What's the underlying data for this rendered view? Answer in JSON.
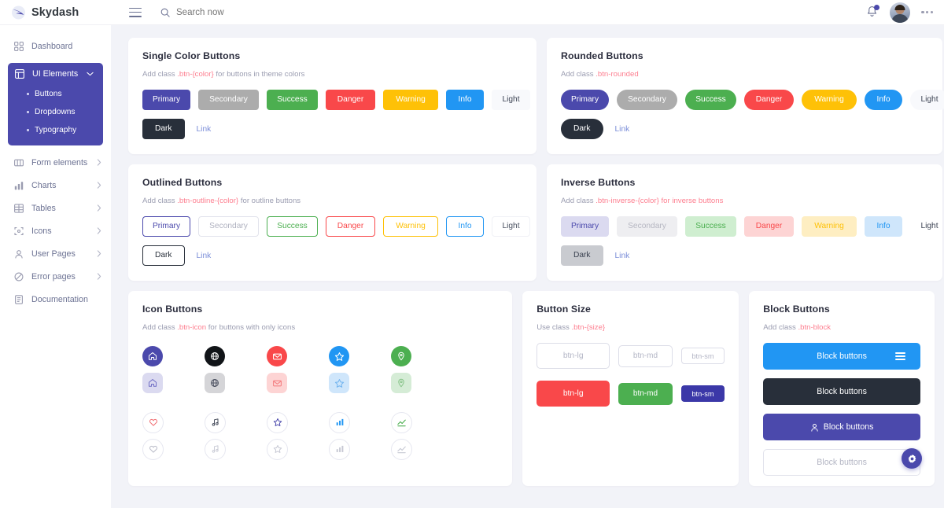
{
  "brand": {
    "name": "Skydash",
    "logo_icon": "wing-logo-icon"
  },
  "header": {
    "menu_icon": "hamburger-icon",
    "search_icon": "search-icon",
    "search_placeholder": "Search now",
    "search_value": "",
    "bell_icon": "bell-icon",
    "avatar_icon": "user-avatar",
    "more_icon": "more-horizontal-icon"
  },
  "sidebar": {
    "items": [
      {
        "label": "Dashboard",
        "icon": "grid-icon",
        "has_chevron": false,
        "active": false
      },
      {
        "label": "UI Elements",
        "icon": "layout-icon",
        "has_chevron": true,
        "active": true,
        "children": [
          {
            "label": "Buttons",
            "active": true
          },
          {
            "label": "Dropdowns",
            "active": false
          },
          {
            "label": "Typography",
            "active": false
          }
        ]
      },
      {
        "label": "Form elements",
        "icon": "columns-icon",
        "has_chevron": true,
        "active": false
      },
      {
        "label": "Charts",
        "icon": "bar-chart-icon",
        "has_chevron": true,
        "active": false
      },
      {
        "label": "Tables",
        "icon": "table-icon",
        "has_chevron": true,
        "active": false
      },
      {
        "label": "Icons",
        "icon": "icons-icon",
        "has_chevron": true,
        "active": false
      },
      {
        "label": "User Pages",
        "icon": "user-icon",
        "has_chevron": true,
        "active": false
      },
      {
        "label": "Error pages",
        "icon": "slash-icon",
        "has_chevron": true,
        "active": false
      },
      {
        "label": "Documentation",
        "icon": "file-text-icon",
        "has_chevron": false,
        "active": false
      }
    ]
  },
  "colors": {
    "primary": "#4B49AC",
    "secondary": "#acacac",
    "success": "#4caf50",
    "danger": "#f9484a",
    "warning": "#fec107",
    "info": "#2196f3",
    "light": "#f8f9fc",
    "dark": "#282f3a",
    "link": "#7a8dd8",
    "code": "#fd7e8f",
    "page_bg": "#f2f3f8"
  },
  "cards": {
    "single_color": {
      "title": "Single Color Buttons",
      "desc_prefix": "Add class",
      "desc_code": ".btn-{color}",
      "desc_suffix": "for buttons in theme colors",
      "buttons": [
        {
          "label": "Primary",
          "variant": "primary"
        },
        {
          "label": "Secondary",
          "variant": "secondary"
        },
        {
          "label": "Success",
          "variant": "success"
        },
        {
          "label": "Danger",
          "variant": "danger"
        },
        {
          "label": "Warning",
          "variant": "warning"
        },
        {
          "label": "Info",
          "variant": "info"
        },
        {
          "label": "Light",
          "variant": "light"
        },
        {
          "label": "Dark",
          "variant": "dark"
        }
      ],
      "link_label": "Link"
    },
    "rounded": {
      "title": "Rounded Buttons",
      "desc_prefix": "Add class",
      "desc_code": ".btn-rounded",
      "desc_suffix": "",
      "buttons": [
        {
          "label": "Primary",
          "variant": "primary"
        },
        {
          "label": "Secondary",
          "variant": "secondary"
        },
        {
          "label": "Success",
          "variant": "success"
        },
        {
          "label": "Danger",
          "variant": "danger"
        },
        {
          "label": "Warning",
          "variant": "warning"
        },
        {
          "label": "Info",
          "variant": "info"
        },
        {
          "label": "Light",
          "variant": "light"
        },
        {
          "label": "Dark",
          "variant": "dark"
        }
      ],
      "link_label": "Link"
    },
    "outlined": {
      "title": "Outlined Buttons",
      "desc_prefix": "Add class",
      "desc_code": ".btn-outline-{color}",
      "desc_suffix": "for outline buttons",
      "buttons": [
        {
          "label": "Primary",
          "variant": "primary"
        },
        {
          "label": "Secondary",
          "variant": "secondary"
        },
        {
          "label": "Success",
          "variant": "success"
        },
        {
          "label": "Danger",
          "variant": "danger"
        },
        {
          "label": "Warning",
          "variant": "warning"
        },
        {
          "label": "Info",
          "variant": "info"
        },
        {
          "label": "Light",
          "variant": "light"
        },
        {
          "label": "Dark",
          "variant": "dark"
        }
      ],
      "link_label": "Link"
    },
    "inverse": {
      "title": "Inverse Buttons",
      "desc_prefix": "Add class",
      "desc_code": ".btn-inverse-{color}",
      "desc_suffix": "for inverse buttons",
      "buttons": [
        {
          "label": "Primary",
          "variant": "primary"
        },
        {
          "label": "Secondary",
          "variant": "secondary"
        },
        {
          "label": "Success",
          "variant": "success"
        },
        {
          "label": "Danger",
          "variant": "danger"
        },
        {
          "label": "Warning",
          "variant": "warning"
        },
        {
          "label": "Info",
          "variant": "info"
        },
        {
          "label": "Light",
          "variant": "light"
        },
        {
          "label": "Dark",
          "variant": "dark"
        }
      ],
      "link_label": "Link"
    },
    "icon_buttons": {
      "title": "Icon Buttons",
      "desc_prefix": "Add class",
      "desc_code": ".btn-icon",
      "desc_suffix": "for buttons with only icons",
      "rows": [
        {
          "style": "solid-circle",
          "icons": [
            "home-icon",
            "globe-icon",
            "mail-icon",
            "star-icon",
            "map-pin-icon"
          ],
          "variants": [
            "primary",
            "dark",
            "danger",
            "info",
            "success"
          ]
        },
        {
          "style": "tinted-square",
          "icons": [
            "home-icon",
            "globe-icon",
            "mail-icon",
            "star-icon",
            "map-pin-icon"
          ],
          "variants": [
            "primary",
            "secondary",
            "danger",
            "info",
            "success"
          ]
        },
        {
          "style": "outline-circle",
          "icons": [
            "heart-icon",
            "music-icon",
            "star-icon",
            "bar-chart-icon",
            "trending-up-icon"
          ],
          "variants": [
            "danger",
            "dark",
            "primary",
            "info",
            "success"
          ]
        },
        {
          "style": "outline-circle-muted",
          "icons": [
            "heart-icon",
            "music-icon",
            "star-icon",
            "bar-chart-icon",
            "trending-up-icon"
          ],
          "variants": [
            "muted",
            "muted",
            "muted",
            "muted",
            "muted"
          ]
        }
      ]
    },
    "button_size": {
      "title": "Button Size",
      "desc_prefix": "Use class",
      "desc_code": ".btn-{size}",
      "desc_suffix": "",
      "outline_row": [
        {
          "label": "btn-lg",
          "size": "lg"
        },
        {
          "label": "btn-md",
          "size": "md"
        },
        {
          "label": "btn-sm",
          "size": "sm"
        }
      ],
      "solid_row": [
        {
          "label": "btn-lg",
          "size": "lg",
          "variant": "danger"
        },
        {
          "label": "btn-md",
          "size": "md",
          "variant": "success"
        },
        {
          "label": "btn-sm",
          "size": "sm",
          "variant": "primary"
        }
      ]
    },
    "block_buttons": {
      "title": "Block Buttons",
      "desc_prefix": "Add class",
      "desc_code": ".btn-block",
      "desc_suffix": "",
      "buttons": [
        {
          "label": "Block buttons",
          "variant": "info",
          "trailing_icon": "menu-icon",
          "leading_icon": ""
        },
        {
          "label": "Block buttons",
          "variant": "dark",
          "trailing_icon": "",
          "leading_icon": ""
        },
        {
          "label": "Block buttons",
          "variant": "primary",
          "trailing_icon": "",
          "leading_icon": "user-icon"
        },
        {
          "label": "Block buttons",
          "variant": "outline-light",
          "trailing_icon": "",
          "leading_icon": ""
        }
      ]
    }
  },
  "fab": {
    "icon": "gear-icon"
  }
}
